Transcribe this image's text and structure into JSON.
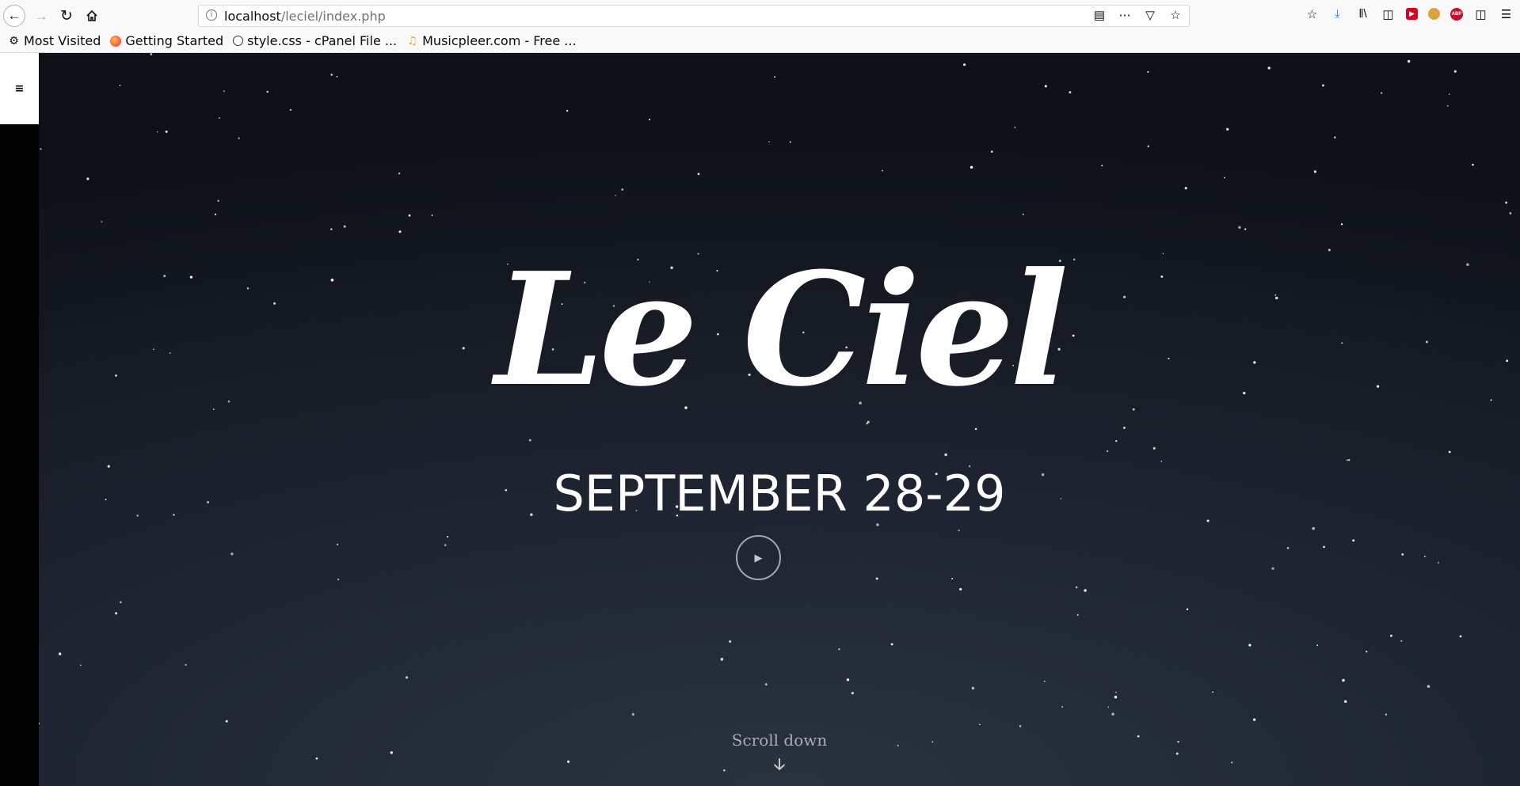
{
  "browser": {
    "url_host": "localhost",
    "url_path": "/leciel/index.php",
    "icons": {
      "back": "arrow-left-icon",
      "forward": "arrow-right-icon",
      "reload": "reload-icon",
      "home": "home-icon",
      "info": "info-icon",
      "reader": "reader-view-icon",
      "more": "more-icon",
      "pocket": "pocket-icon",
      "bookmark_star": "star-icon"
    },
    "toolbar_icons": [
      "bookmark-star-icon",
      "download-icon",
      "library-icon",
      "sidebar-icon",
      "extension-red-icon",
      "monkey-icon",
      "adblock-icon",
      "clipboard-icon",
      "menu-icon"
    ],
    "adblock_label": "ABP",
    "bookmarks": [
      {
        "label": "Most Visited",
        "icon": "gear-icon"
      },
      {
        "label": "Getting Started",
        "icon": "firefox-icon"
      },
      {
        "label": "style.css - cPanel File ...",
        "icon": "globe-icon"
      },
      {
        "label": "Musicpleer.com - Free ...",
        "icon": "musicpleer-icon"
      }
    ]
  },
  "page": {
    "menu_icon": "hamburger-icon",
    "title": "Le Ciel",
    "date": "SEPTEMBER 28-29",
    "play_icon": "play-icon",
    "scroll_label": "Scroll down",
    "scroll_icon": "arrow-down-icon"
  },
  "colors": {
    "sky_dark": "#0d1016",
    "sky_light": "#2a3240",
    "text": "#ffffff",
    "download_accent": "#0a84ff"
  }
}
